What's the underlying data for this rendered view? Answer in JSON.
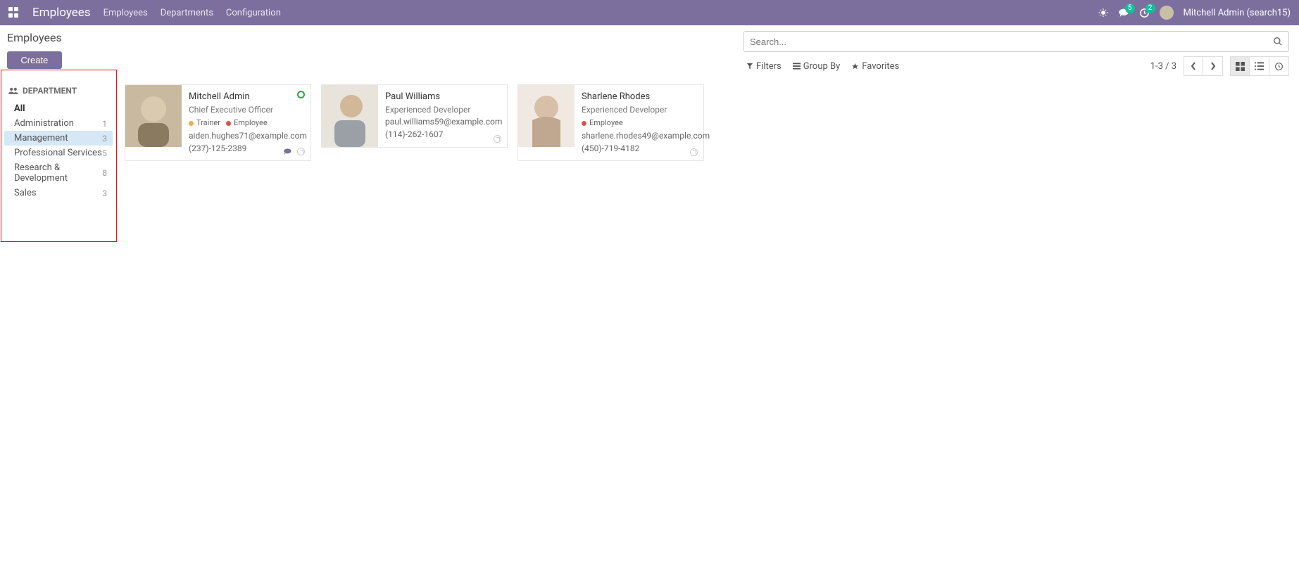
{
  "navbar": {
    "brand": "Employees",
    "links": [
      "Employees",
      "Departments",
      "Configuration"
    ],
    "messages_badge": "5",
    "activities_badge": "2",
    "user": "Mitchell Admin (search15)"
  },
  "control": {
    "breadcrumb": "Employees",
    "create_label": "Create",
    "search_placeholder": "Search...",
    "filters_label": "Filters",
    "groupby_label": "Group By",
    "favorites_label": "Favorites",
    "pager": "1-3 / 3"
  },
  "sidebar": {
    "header": "DEPARTMENT",
    "all_label": "All",
    "items": [
      {
        "label": "Administration",
        "count": "1"
      },
      {
        "label": "Management",
        "count": "3",
        "selected": true
      },
      {
        "label": "Professional Services",
        "count": "5"
      },
      {
        "label": "Research & Development",
        "count": "8"
      },
      {
        "label": "Sales",
        "count": "3"
      }
    ]
  },
  "cards": [
    {
      "name": "Mitchell Admin",
      "title": "Chief Executive Officer",
      "tags": [
        {
          "color": "orange",
          "label": "Trainer"
        },
        {
          "color": "red",
          "label": "Employee"
        }
      ],
      "email": "aiden.hughes71@example.com",
      "phone": "(237)-125-2389",
      "online": true,
      "has_chat": true
    },
    {
      "name": "Paul Williams",
      "title": "Experienced Developer",
      "tags": [],
      "email": "paul.williams59@example.com",
      "phone": "(114)-262-1607",
      "online": false,
      "has_chat": false
    },
    {
      "name": "Sharlene Rhodes",
      "title": "Experienced Developer",
      "tags": [
        {
          "color": "red",
          "label": "Employee"
        }
      ],
      "email": "sharlene.rhodes49@example.com",
      "phone": "(450)-719-4182",
      "online": false,
      "has_chat": false
    }
  ]
}
